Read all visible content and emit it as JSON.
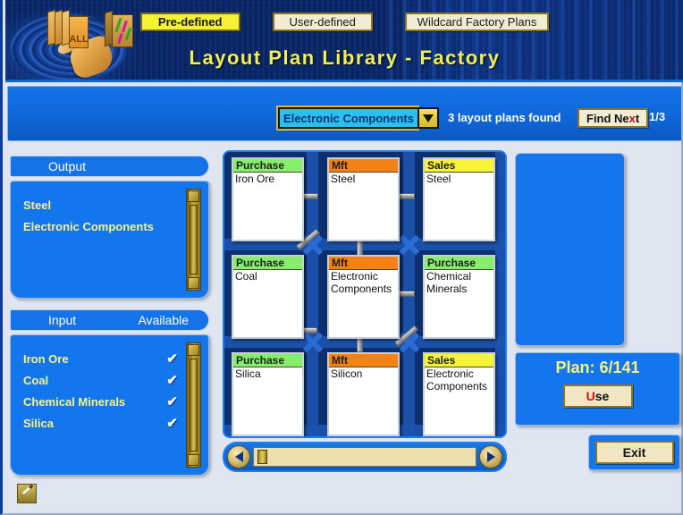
{
  "window": {
    "title": "Layout Plan Library - Factory"
  },
  "header": {
    "tabs": [
      {
        "label": "Pre-defined",
        "active": true
      },
      {
        "label": "User-defined",
        "active": false
      },
      {
        "label": "Wildcard Factory Plans",
        "active": false
      }
    ]
  },
  "toolbar": {
    "all_books_icon": "books-all-icon",
    "single_book_icon": "book-icon",
    "filter_value": "Electronic Components",
    "dropdown_arrow_icon": "chevron-down-icon",
    "found_text": "3 layout plans found",
    "find_next_label": "Find Ne",
    "find_next_accel": "x",
    "find_next_label_tail": "t",
    "page_fraction": "1/3"
  },
  "output_panel": {
    "header": "Output",
    "items": [
      {
        "label": "Steel"
      },
      {
        "label": "Electronic Components"
      }
    ]
  },
  "input_panel": {
    "header": "Input",
    "header_right": "Available",
    "check_glyph": "✔",
    "items": [
      {
        "label": "Iron Ore",
        "available": true
      },
      {
        "label": "Coal",
        "available": true
      },
      {
        "label": "Chemical Minerals",
        "available": true
      },
      {
        "label": "Silica",
        "available": true
      }
    ]
  },
  "grid": {
    "cards": [
      {
        "type": "Purchase",
        "kind": "purchase",
        "name": "Iron Ore",
        "col": 0,
        "row": 0
      },
      {
        "type": "Mft",
        "kind": "mft",
        "name": "Steel",
        "col": 1,
        "row": 0
      },
      {
        "type": "Sales",
        "kind": "sales",
        "name": "Steel",
        "col": 2,
        "row": 0
      },
      {
        "type": "Purchase",
        "kind": "purchase",
        "name": "Coal",
        "col": 0,
        "row": 1
      },
      {
        "type": "Mft",
        "kind": "mft",
        "name": "Electronic Components",
        "col": 1,
        "row": 1
      },
      {
        "type": "Purchase",
        "kind": "purchase",
        "name": "Chemical Minerals",
        "col": 2,
        "row": 1
      },
      {
        "type": "Purchase",
        "kind": "purchase",
        "name": "Silica",
        "col": 0,
        "row": 2
      },
      {
        "type": "Mft",
        "kind": "mft",
        "name": "Silicon",
        "col": 1,
        "row": 2
      },
      {
        "type": "Sales",
        "kind": "sales",
        "name": "Electronic Components",
        "col": 2,
        "row": 2
      }
    ]
  },
  "scrollbar": {
    "left_arrow_icon": "arrow-left-icon",
    "right_arrow_icon": "arrow-right-icon"
  },
  "right_panel": {
    "plan_label": "Plan: 6/141",
    "use_accel": "U",
    "use_label_tail": "se",
    "exit_label": "Exit"
  },
  "status_bar": {
    "edit_icon": "pencil-icon"
  },
  "colors": {
    "accent_blue": "#1476ec",
    "deep_blue": "#0c2f6e",
    "purchase": "#85ef6b",
    "mft": "#f58213",
    "sales": "#f7f437",
    "gold": "#f0e7c2",
    "tab_active": "#f5f135",
    "title_yellow": "#f2ef52"
  }
}
